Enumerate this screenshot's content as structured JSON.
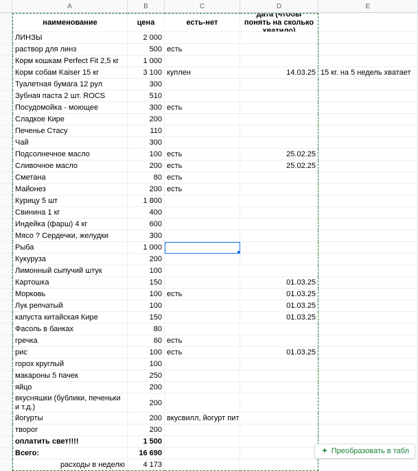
{
  "columns": [
    "A",
    "B",
    "C",
    "D",
    "E"
  ],
  "headers": {
    "a": "наименование",
    "b": "цена",
    "c": "есть-нет",
    "d": "дата (чтобы понять на сколько хватило)",
    "e": ""
  },
  "rows": [
    {
      "a": "ЛИНЗЫ",
      "b": "2 000",
      "c": "",
      "d": "",
      "e": ""
    },
    {
      "a": "раствор для линз",
      "b": "500",
      "c": "есть",
      "d": "",
      "e": ""
    },
    {
      "a": "Корм кошкам Perfect Fit 2,5 кг",
      "b": "1 000",
      "c": "",
      "d": "",
      "e": ""
    },
    {
      "a": "Корм собам Kaiser 15 кг",
      "b": "3 100",
      "c": "куплен",
      "d": "14.03.25",
      "e": "15 кг. на 5 недель хватает"
    },
    {
      "a": "Туалетная бумага 12 рул",
      "b": "300",
      "c": "",
      "d": "",
      "e": ""
    },
    {
      "a": "Зубная паста 2 шт. ROCS",
      "b": "510",
      "c": "",
      "d": "",
      "e": ""
    },
    {
      "a": "Посудомойка - моющее",
      "b": "300",
      "c": "есть",
      "d": "",
      "e": ""
    },
    {
      "a": "Сладкое Кире",
      "b": "200",
      "c": "",
      "d": "",
      "e": ""
    },
    {
      "a": "Печенье Стасу",
      "b": "110",
      "c": "",
      "d": "",
      "e": ""
    },
    {
      "a": "Чай",
      "b": "300",
      "c": "",
      "d": "",
      "e": ""
    },
    {
      "a": "Подсолнечное масло",
      "b": "100",
      "c": "есть",
      "d": "25.02.25",
      "e": ""
    },
    {
      "a": "Сливочное масло",
      "b": "200",
      "c": "есть",
      "d": "25.02.25",
      "e": ""
    },
    {
      "a": "Сметана",
      "b": "80",
      "c": "есть",
      "d": "",
      "e": ""
    },
    {
      "a": "Майонез",
      "b": "200",
      "c": "есть",
      "d": "",
      "e": ""
    },
    {
      "a": "Курицу 5 шт",
      "b": "1 800",
      "c": "",
      "d": "",
      "e": ""
    },
    {
      "a": "Свинина 1 кг",
      "b": "400",
      "c": "",
      "d": "",
      "e": ""
    },
    {
      "a": "Индейка (фарш) 4 кг",
      "b": "600",
      "c": "",
      "d": "",
      "e": ""
    },
    {
      "a": "Мясо ? Сердечки, желудки",
      "b": "300",
      "c": "",
      "d": "",
      "e": ""
    },
    {
      "a": "Рыба",
      "b": "1 000",
      "c": "",
      "d": "",
      "e": "",
      "active": true
    },
    {
      "a": "Кукуруза",
      "b": "200",
      "c": "",
      "d": "",
      "e": ""
    },
    {
      "a": "Лимонный сыпучий штук",
      "b": "100",
      "c": "",
      "d": "",
      "e": ""
    },
    {
      "a": "Картошка",
      "b": "150",
      "c": "",
      "d": "01.03.25",
      "e": ""
    },
    {
      "a": "Морковь",
      "b": "100",
      "c": "есть",
      "d": "01.03.25",
      "e": ""
    },
    {
      "a": "Лук репчатый",
      "b": "100",
      "c": "",
      "d": "01.03.25",
      "e": ""
    },
    {
      "a": "капуста китайская Кире",
      "b": "150",
      "c": "",
      "d": "01.03.25",
      "e": ""
    },
    {
      "a": "Фасоль в банках",
      "b": "80",
      "c": "",
      "d": "",
      "e": ""
    },
    {
      "a": "гречка",
      "b": "60",
      "c": "есть",
      "d": "",
      "e": ""
    },
    {
      "a": "рис",
      "b": "100",
      "c": "есть",
      "d": "01.03.25",
      "e": ""
    },
    {
      "a": "горох круглый",
      "b": "100",
      "c": "",
      "d": "",
      "e": ""
    },
    {
      "a": "макароны 5 пачек",
      "b": "250",
      "c": "",
      "d": "",
      "e": ""
    },
    {
      "a": "яйцо",
      "b": "200",
      "c": "",
      "d": "",
      "e": ""
    },
    {
      "a": "вкусняшки (бублики, печеньки и т.д.)",
      "b": "200",
      "c": "",
      "d": "",
      "e": "",
      "wrap": true
    },
    {
      "a": "йогурты",
      "b": "200",
      "c": "вкусвилл, йогурт питьевой",
      "d": "",
      "e": ""
    },
    {
      "a": "творог",
      "b": "200",
      "c": "",
      "d": "",
      "e": ""
    },
    {
      "a": "оплатить свет!!!!",
      "b": "1 500",
      "c": "",
      "d": "",
      "e": "",
      "bold": true
    },
    {
      "a": "Всего:",
      "b": "16 690",
      "c": "",
      "d": "",
      "e": "",
      "bold": true
    },
    {
      "a": "расходы в неделю",
      "b": "4 173",
      "c": "",
      "d": "",
      "e": "",
      "right_a": true,
      "last": true
    }
  ],
  "ui": {
    "convert_label": "Преобразовать в табл"
  }
}
